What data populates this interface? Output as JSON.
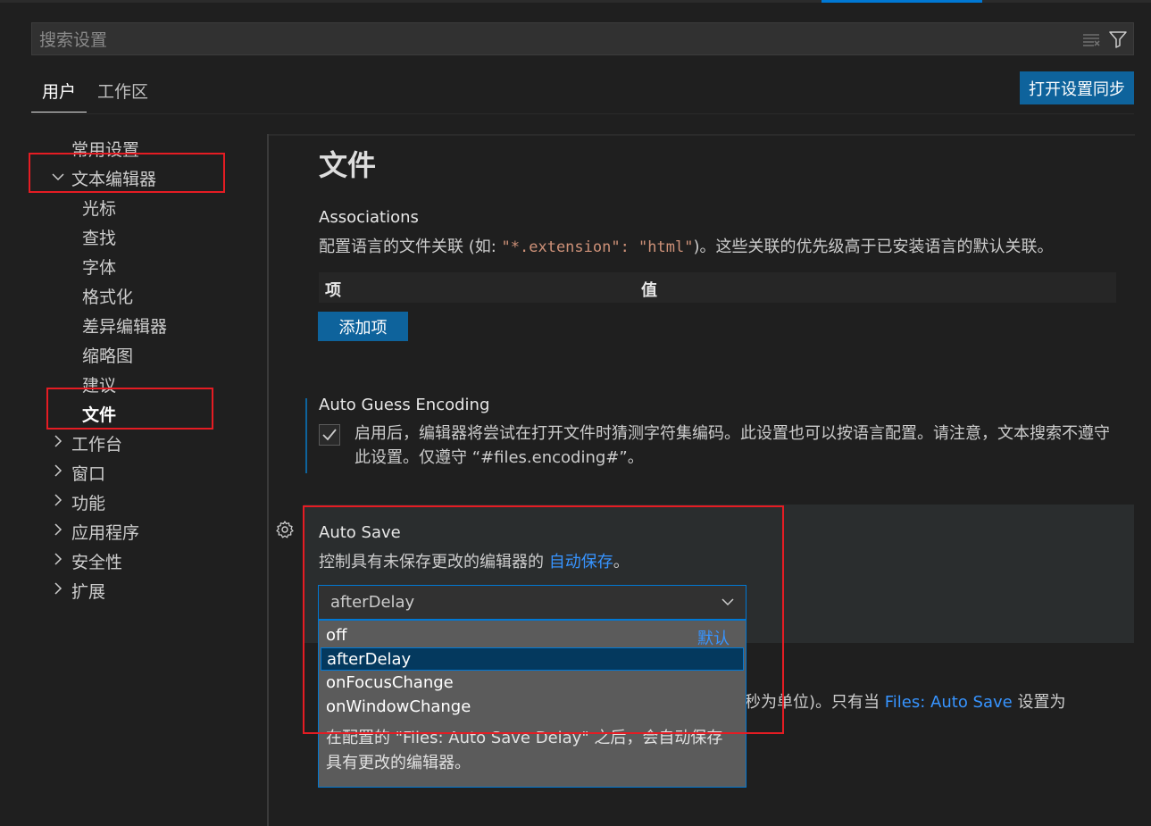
{
  "search": {
    "placeholder": "搜索设置"
  },
  "scope_tabs": {
    "user": "用户",
    "workspace": "工作区"
  },
  "sync_button": "打开设置同步",
  "toc": {
    "common": "常用设置",
    "text_editor": "文本编辑器",
    "cursor": "光标",
    "find": "查找",
    "font": "字体",
    "formatting": "格式化",
    "diff_editor": "差异编辑器",
    "minimap": "缩略图",
    "suggestions": "建议",
    "files": "文件",
    "workbench": "工作台",
    "window": "窗口",
    "features": "功能",
    "application": "应用程序",
    "security": "安全性",
    "extensions": "扩展"
  },
  "section_title": "文件",
  "associations": {
    "title": "Associations",
    "desc_pre": "配置语言的文件关联 (如: ",
    "desc_code": "\"*.extension\": \"html\"",
    "desc_post": ")。这些关联的优先级高于已安装语言的默认关联。",
    "col_item": "项",
    "col_value": "值",
    "add_button": "添加项"
  },
  "auto_guess": {
    "title": "Auto Guess Encoding",
    "desc": "启用后，编辑器将尝试在打开文件时猜测字符集编码。此设置也可以按语言配置。请注意，文本搜索不遵守此设置。仅遵守 “#files.encoding#”。",
    "checked": true
  },
  "auto_save": {
    "title": "Auto Save",
    "desc_pre": "控制具有未保存更改的编辑器的 ",
    "desc_link": "自动保存",
    "desc_post": "。",
    "value": "afterDelay",
    "options": [
      "off",
      "afterDelay",
      "onFocusChange",
      "onWindowChange"
    ],
    "default_label": "默认",
    "option_desc": "在配置的 \"Files: Auto Save Delay\" 之后，会自动保存具有更改的编辑器。"
  },
  "behind_text": {
    "pre": "秒为单位)。只有当 ",
    "link": "Files: Auto Save",
    "post": " 设置为"
  }
}
